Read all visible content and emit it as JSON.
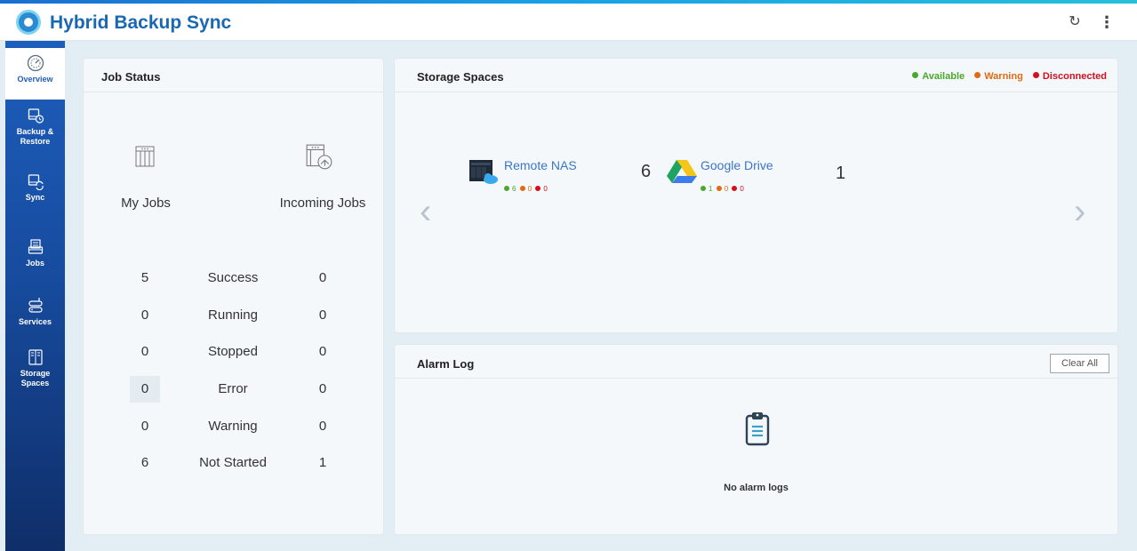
{
  "app": {
    "title": "Hybrid Backup Sync"
  },
  "header": {
    "refresh_icon": "refresh-icon",
    "more_icon": "more-vertical-icon"
  },
  "sidebar": {
    "items": [
      {
        "label": "Overview",
        "icon": "dashboard-icon",
        "active": true
      },
      {
        "label": "Backup & Restore",
        "icon": "backup-restore-icon"
      },
      {
        "label": "Sync",
        "icon": "sync-icon"
      },
      {
        "label": "Jobs",
        "icon": "jobs-icon"
      },
      {
        "label": "Services",
        "icon": "services-icon"
      },
      {
        "label": "Storage Spaces",
        "icon": "storage-spaces-icon"
      }
    ]
  },
  "job_status": {
    "title": "Job Status",
    "my_jobs_label": "My Jobs",
    "incoming_jobs_label": "Incoming Jobs",
    "rows": [
      {
        "label": "Success",
        "my": "5",
        "incoming": "0"
      },
      {
        "label": "Running",
        "my": "0",
        "incoming": "0"
      },
      {
        "label": "Stopped",
        "my": "0",
        "incoming": "0"
      },
      {
        "label": "Error",
        "my": "0",
        "incoming": "0"
      },
      {
        "label": "Warning",
        "my": "0",
        "incoming": "0"
      },
      {
        "label": "Not Started",
        "my": "6",
        "incoming": "1"
      }
    ]
  },
  "storage_spaces": {
    "title": "Storage Spaces",
    "legend": {
      "available": "Available",
      "warning": "Warning",
      "disconnected": "Disconnected"
    },
    "colors": {
      "available": "#4ca62e",
      "warning": "#e06b13",
      "disconnected": "#d4101e"
    },
    "items": [
      {
        "name": "Remote NAS",
        "count": "6",
        "available": "6",
        "warning": "0",
        "disconnected": "0",
        "icon": "remote-nas-icon"
      },
      {
        "name": "Google Drive",
        "count": "1",
        "available": "1",
        "warning": "0",
        "disconnected": "0",
        "icon": "google-drive-icon"
      }
    ]
  },
  "alarm_log": {
    "title": "Alarm Log",
    "clear_label": "Clear All",
    "empty_text": "No alarm logs"
  }
}
